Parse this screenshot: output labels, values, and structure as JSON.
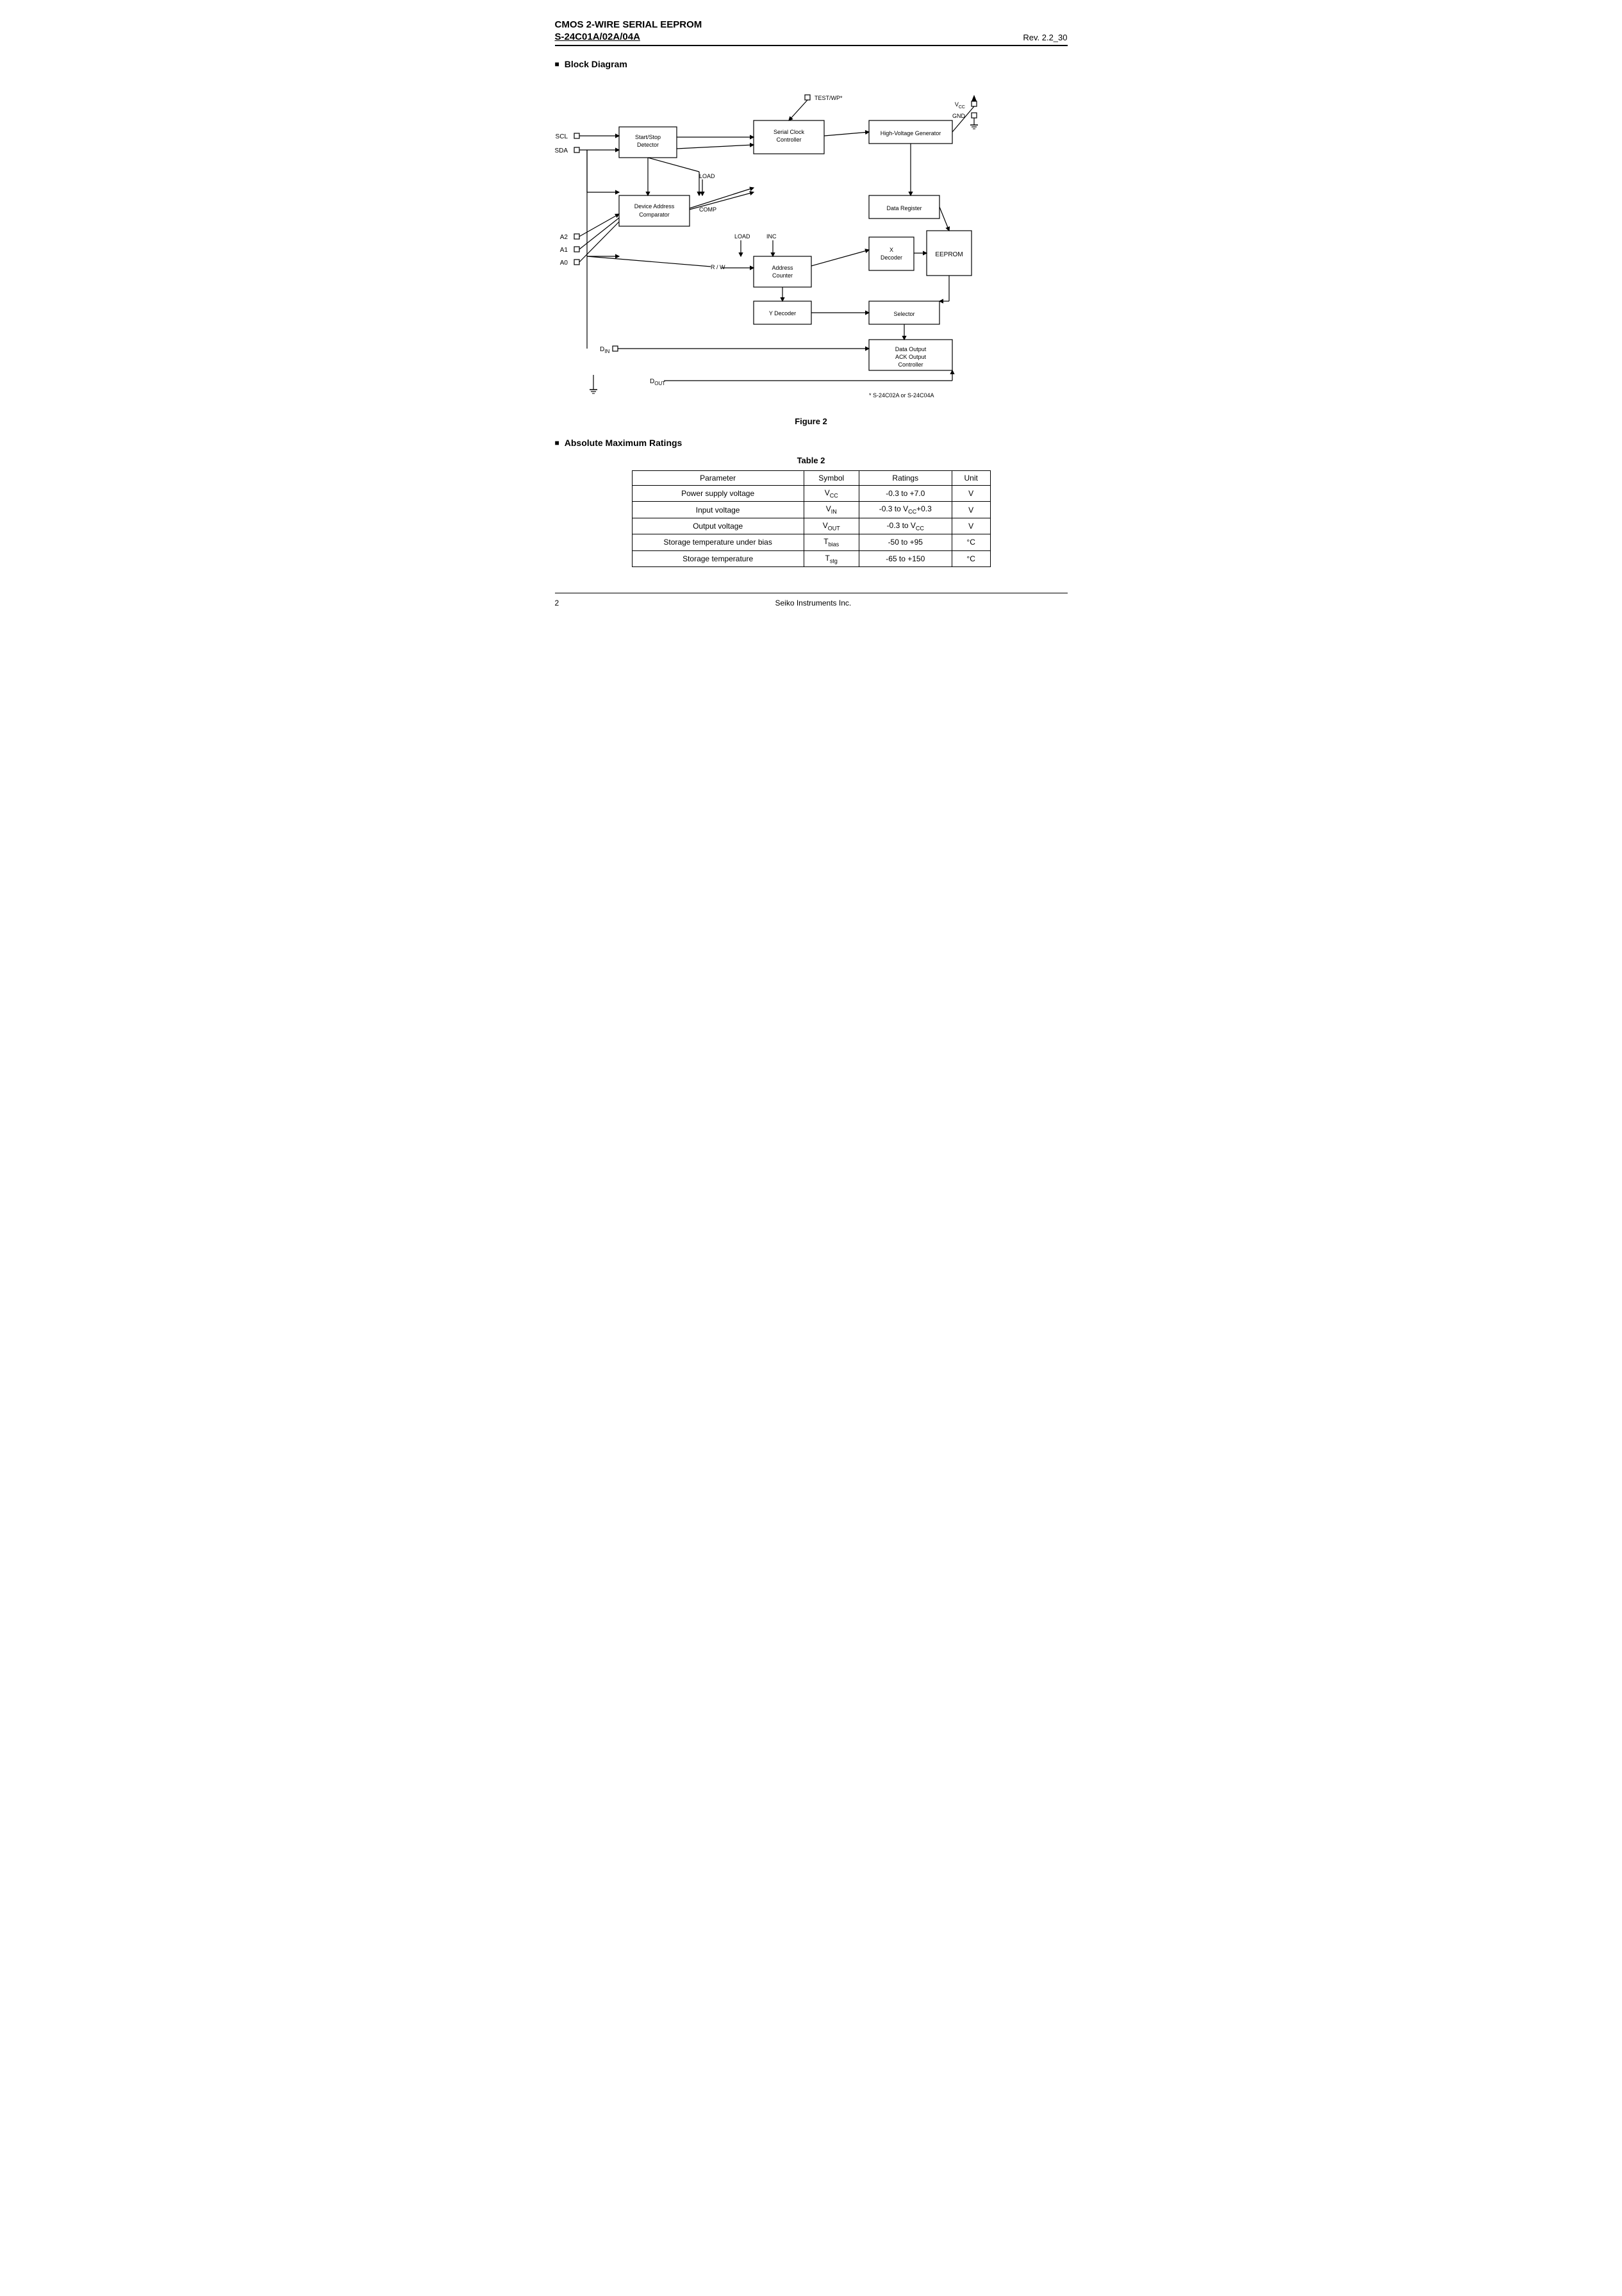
{
  "header": {
    "title": "CMOS 2-WIRE SERIAL  EEPROM",
    "subtitle": "S-24C01A/02A/04A",
    "rev": "Rev. 2.2_30"
  },
  "sections": {
    "block_diagram": {
      "label": "Block Diagram",
      "figure_label": "Figure 2",
      "footnote": "* S-24C02A or S-24C04A"
    },
    "ratings": {
      "label": "Absolute Maximum Ratings",
      "table_label": "Table  2",
      "columns": [
        "Parameter",
        "Symbol",
        "Ratings",
        "Unit"
      ],
      "rows": [
        [
          "Power supply voltage",
          "V_CC",
          "-0.3 to +7.0",
          "V"
        ],
        [
          "Input voltage",
          "V_IN",
          "-0.3 to V_CC+0.3",
          "V"
        ],
        [
          "Output voltage",
          "V_OUT",
          "-0.3 to V_CC",
          "V"
        ],
        [
          "Storage temperature under bias",
          "T_bias",
          "-50 to +95",
          "°C"
        ],
        [
          "Storage temperature",
          "T_stg",
          "-65 to +150",
          "°C"
        ]
      ]
    }
  },
  "footer": {
    "page": "2",
    "company": "Seiko Instruments Inc."
  }
}
